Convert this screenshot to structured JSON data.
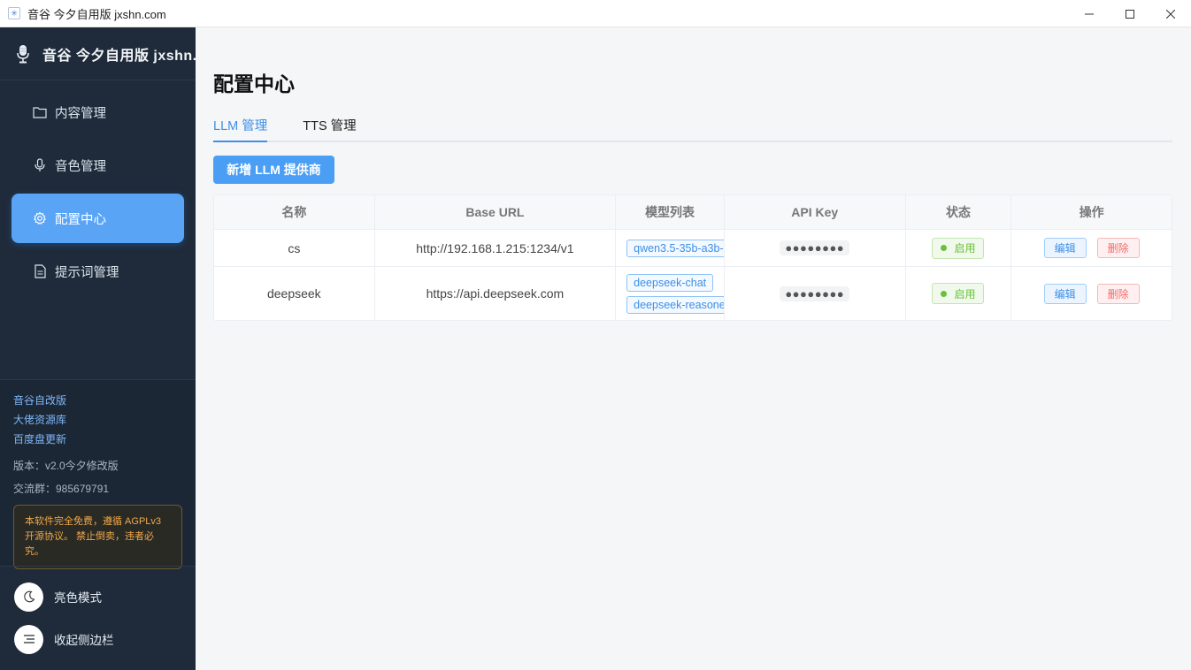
{
  "window": {
    "title": "音谷 今夕自用版 jxshn.com",
    "app_icon_glyph": "✳",
    "minimize_glyph": "—",
    "maximize_glyph": "☐",
    "close_glyph": "✕"
  },
  "sidebar": {
    "brand": "音谷 今夕自用版 jxshn.",
    "items": [
      {
        "label": "内容管理",
        "icon": "folder-icon",
        "active": false
      },
      {
        "label": "音色管理",
        "icon": "microphone-icon",
        "active": false
      },
      {
        "label": "配置中心",
        "icon": "gear-icon",
        "active": true
      },
      {
        "label": "提示词管理",
        "icon": "document-icon",
        "active": false
      }
    ],
    "links": [
      "音谷自改版",
      "大佬资源库",
      "百度盘更新"
    ],
    "version": "版本：v2.0今夕修改版",
    "group": "交流群：985679791",
    "notice": "本软件完全免费，遵循 AGPLv3 开源协议。 禁止倒卖，违者必究。",
    "theme_toggle": "亮色模式",
    "collapse": "收起侧边栏"
  },
  "main": {
    "title": "配置中心",
    "tabs": [
      {
        "label": "LLM 管理",
        "active": true
      },
      {
        "label": "TTS 管理",
        "active": false
      }
    ],
    "add_button": "新增 LLM 提供商",
    "table": {
      "headers": [
        "名称",
        "Base URL",
        "模型列表",
        "API Key",
        "状态",
        "操作"
      ],
      "rows": [
        {
          "name": "cs",
          "base_url": "http://192.168.1.215:1234/v1",
          "models": [
            "qwen3.5-35b-a3b-"
          ],
          "api_key": "●●●●●●●●",
          "status": "启用",
          "edit": "编辑",
          "delete": "删除"
        },
        {
          "name": "deepseek",
          "base_url": "https://api.deepseek.com",
          "models": [
            "deepseek-chat",
            "deepseek-reasone"
          ],
          "api_key": "●●●●●●●●",
          "status": "启用",
          "edit": "编辑",
          "delete": "删除"
        }
      ]
    }
  },
  "colors": {
    "sidebar_bg": "#1f2b3a",
    "accent": "#4a9ff5",
    "active_nav": "#5aa4f5",
    "status_green": "#67c23a",
    "danger": "#f56c6c"
  }
}
